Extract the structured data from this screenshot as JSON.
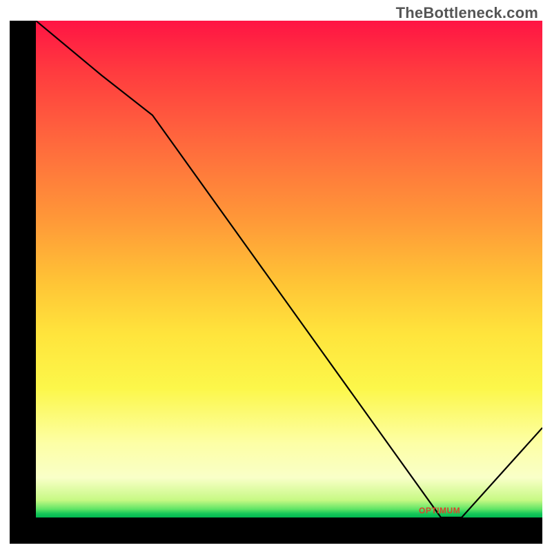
{
  "attribution": "TheBottleneck.com",
  "optimum_label": "OPTIMUM",
  "chart_data": {
    "type": "line",
    "title": "",
    "xlabel": "",
    "ylabel": "",
    "xlim": [
      0,
      100
    ],
    "ylim": [
      0,
      100
    ],
    "x": [
      0,
      13,
      23,
      80,
      84,
      100
    ],
    "values": [
      100,
      89,
      81,
      0,
      0,
      18
    ],
    "gradient_stops": [
      {
        "pct": 0,
        "color": "#ff1444"
      },
      {
        "pct": 25,
        "color": "#ff6a3d"
      },
      {
        "pct": 53,
        "color": "#ffc536"
      },
      {
        "pct": 74,
        "color": "#fcf74a"
      },
      {
        "pct": 92,
        "color": "#f9ffc8"
      },
      {
        "pct": 100,
        "color": "#01b751"
      }
    ],
    "optimum_range_x": [
      80,
      84
    ]
  }
}
